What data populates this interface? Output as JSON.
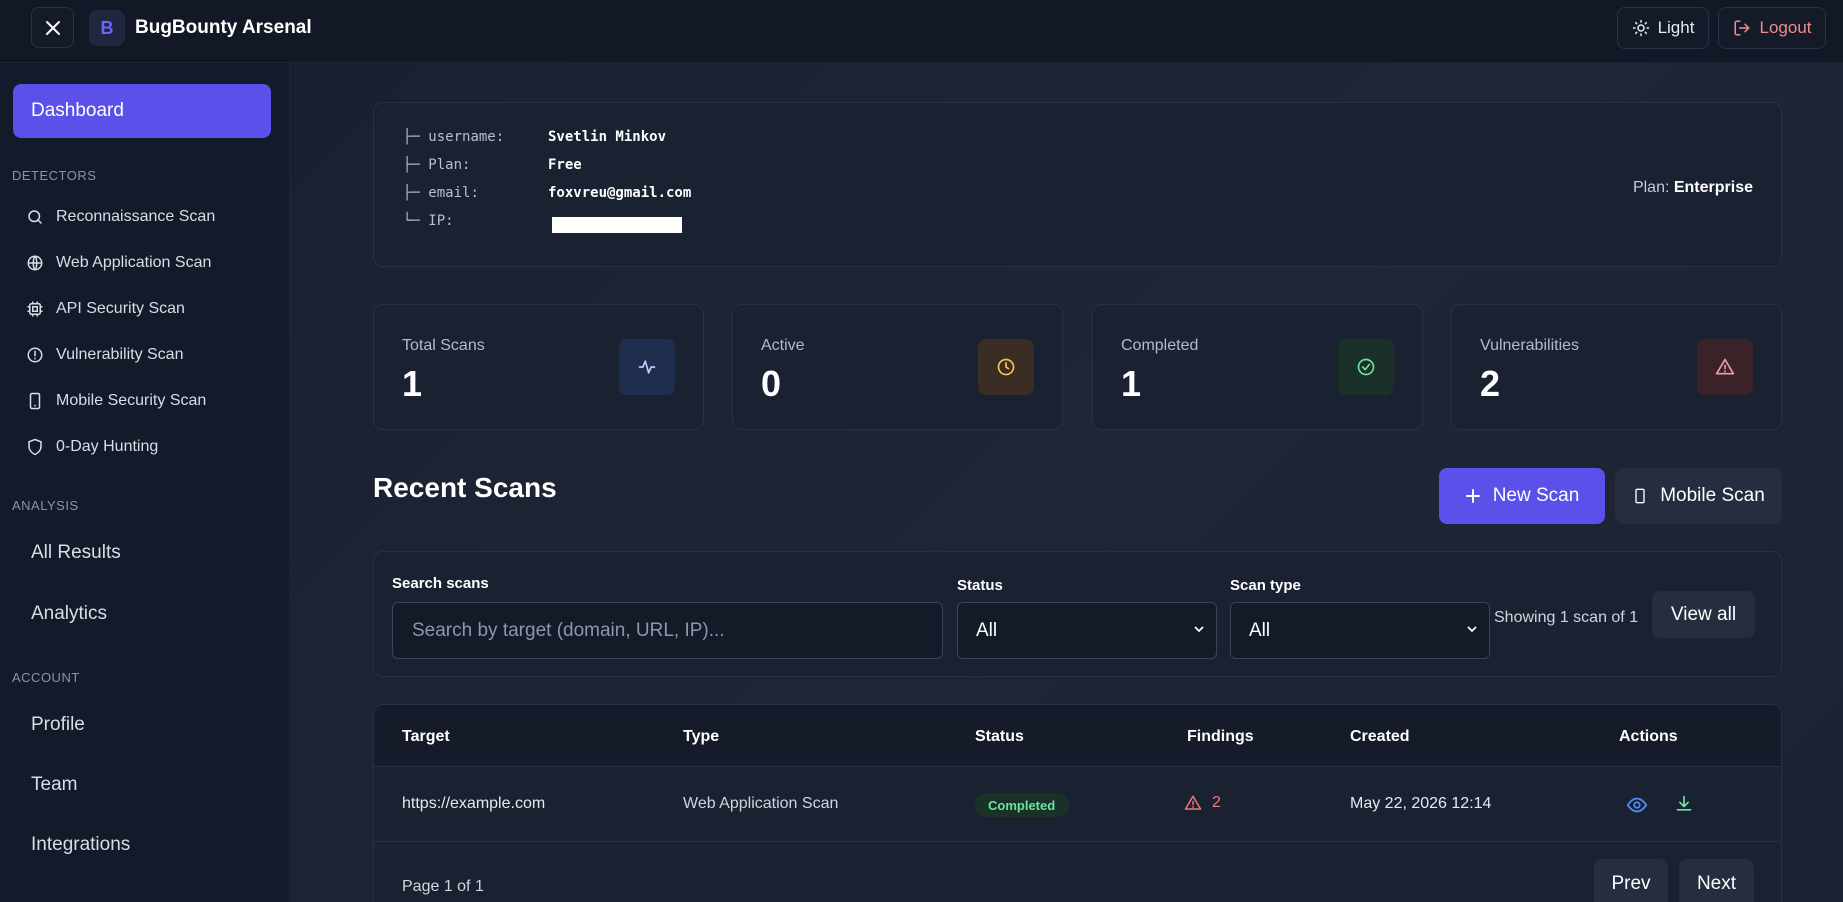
{
  "app": {
    "title": "BugBounty Arsenal",
    "logo_letter": "B"
  },
  "header": {
    "theme_label": "Light",
    "logout_label": "Logout"
  },
  "sidebar": {
    "dashboard": "Dashboard",
    "detectors_heading": "DETECTORS",
    "detectors": [
      {
        "label": "Reconnaissance Scan",
        "icon": "search-icon"
      },
      {
        "label": "Web Application Scan",
        "icon": "globe-icon"
      },
      {
        "label": "API Security Scan",
        "icon": "chip-icon"
      },
      {
        "label": "Vulnerability Scan",
        "icon": "alert-circle-icon"
      },
      {
        "label": "Mobile Security Scan",
        "icon": "smartphone-icon"
      },
      {
        "label": "0-Day Hunting",
        "icon": "shield-icon"
      }
    ],
    "analysis_heading": "ANALYSIS",
    "analysis": [
      "All Results",
      "Analytics"
    ],
    "account_heading": "ACCOUNT",
    "account": [
      "Profile",
      "Team",
      "Integrations"
    ]
  },
  "profile": {
    "rows": [
      {
        "prefix": "├─",
        "key": "username:",
        "value": "Svetlin Minkov"
      },
      {
        "prefix": "├─",
        "key": "Plan:",
        "value": "Free"
      },
      {
        "prefix": "├─",
        "key": "email:",
        "value": "foxvreu@gmail.com"
      },
      {
        "prefix": "└─",
        "key": "IP:",
        "value": ""
      }
    ],
    "plan_label": "Plan:",
    "plan_value": "Enterprise"
  },
  "stats": [
    {
      "label": "Total Scans",
      "value": "1",
      "icon": "activity-icon",
      "color": "#8fa3ff",
      "bg": "#1f2d4f"
    },
    {
      "label": "Active",
      "value": "0",
      "icon": "clock-icon",
      "color": "#f5c451",
      "bg": "#3a2d24"
    },
    {
      "label": "Completed",
      "value": "1",
      "icon": "check-circle-icon",
      "color": "#6ce3a2",
      "bg": "#1b3028"
    },
    {
      "label": "Vulnerabilities",
      "value": "2",
      "icon": "warning-icon",
      "color": "#f0787a",
      "bg": "#3b2229"
    }
  ],
  "recent": {
    "title": "Recent Scans",
    "new_scan_label": "New Scan",
    "mobile_scan_label": "Mobile Scan"
  },
  "filters": {
    "search_label": "Search scans",
    "search_placeholder": "Search by target (domain, URL, IP)...",
    "status_label": "Status",
    "status_value": "All",
    "type_label": "Scan type",
    "type_value": "All",
    "showing_text": "Showing 1 scan of 1",
    "view_all_label": "View all"
  },
  "table": {
    "columns": [
      "Target",
      "Type",
      "Status",
      "Findings",
      "Created",
      "Actions"
    ],
    "rows": [
      {
        "target": "https://example.com",
        "type": "Web Application Scan",
        "status": "Completed",
        "findings": "2",
        "created": "May 22, 2026 12:14"
      }
    ],
    "page_info": "Page 1 of 1",
    "prev_label": "Prev",
    "next_label": "Next"
  },
  "colors": {
    "accent": "#5b50ea",
    "success": "#6ce3a2",
    "danger": "#f0787a",
    "info": "#4c8cf5"
  }
}
